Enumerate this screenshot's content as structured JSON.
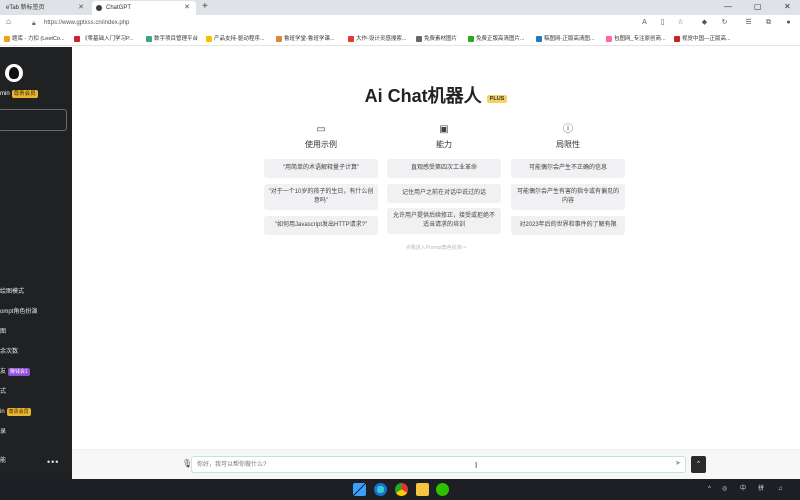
{
  "browser": {
    "tabs": [
      {
        "label": "eTab 新标签页",
        "active": false
      },
      {
        "label": "ChatGPT",
        "active": true
      }
    ],
    "new_tab": "+",
    "window_controls": [
      "—",
      "▢",
      "✕"
    ],
    "url": "https://www.gptxss.cn/index.php",
    "bookmarks": [
      "题库 - 力扣 (LeetCo...",
      "《零基础入门学习P...",
      "数字项目管理平台",
      "产品支持-驱动程序...",
      "鲁班学堂-鲁班学课...",
      "大作-设计灵感搜索...",
      "免费素材图片",
      "免费正版高清图片...",
      "稿图网-正版高清图...",
      "包图网_专注原创商...",
      "视觉中国—正版高..."
    ]
  },
  "sidebar": {
    "username": "min",
    "vip_badge": "尊贵会员",
    "items": [
      {
        "label": "绘图模式",
        "badge": ""
      },
      {
        "label": "ompt角色扮演",
        "badge": ""
      },
      {
        "label": "图",
        "badge": ""
      },
      {
        "label": "余次数",
        "badge": ""
      },
      {
        "label": "友",
        "badge": "赚钱会1"
      },
      {
        "label": "式",
        "badge": ""
      },
      {
        "label": "in",
        "badge": "尊贵会员"
      },
      {
        "label": "录",
        "badge": ""
      },
      {
        "label": "能",
        "badge": ""
      }
    ],
    "more": "•••"
  },
  "main": {
    "title": "Ai Chat机器人",
    "plus_badge": "PLUS",
    "columns": [
      {
        "icon": "chat-icon",
        "glyph": "▭",
        "label": "使用示例",
        "cards": [
          "\"用简单的术语解释量子计算\"",
          "\"对于一个10岁的孩子的生日，有什么创意吗\"",
          "\"如何用Javascript发出HTTP请求?\""
        ]
      },
      {
        "icon": "chip-icon",
        "glyph": "▣",
        "label": "能力",
        "cards": [
          "直观感受第四次工业革命",
          "记住用户之前在对话中说过的话",
          "允许用户提供后续修正，接受或拒绝不适当请求的培训"
        ]
      },
      {
        "icon": "alert-icon",
        "glyph": "ⓘ",
        "label": "局限性",
        "cards": [
          "可能偶尔会产生不正确的信息",
          "可能偶尔会产生有害的指令或有偏见的内容",
          "对2023年后的世界和事件的了解有限"
        ]
      }
    ],
    "prompt_link": "点我进入Prompt角色扮演->"
  },
  "composer": {
    "placeholder": "你好，我可以帮你做什么?",
    "mic_glyph": "🎤",
    "send_glyph": "➤",
    "up_glyph": "⌃"
  },
  "taskbar": {
    "tray": [
      "^",
      "中",
      "拼",
      "♫"
    ]
  },
  "colors": {
    "sidebar_bg": "#202123",
    "vip_gold": "#e8b631",
    "card_bg": "#f1f1f3",
    "plus_yellow": "#f4d35e"
  }
}
